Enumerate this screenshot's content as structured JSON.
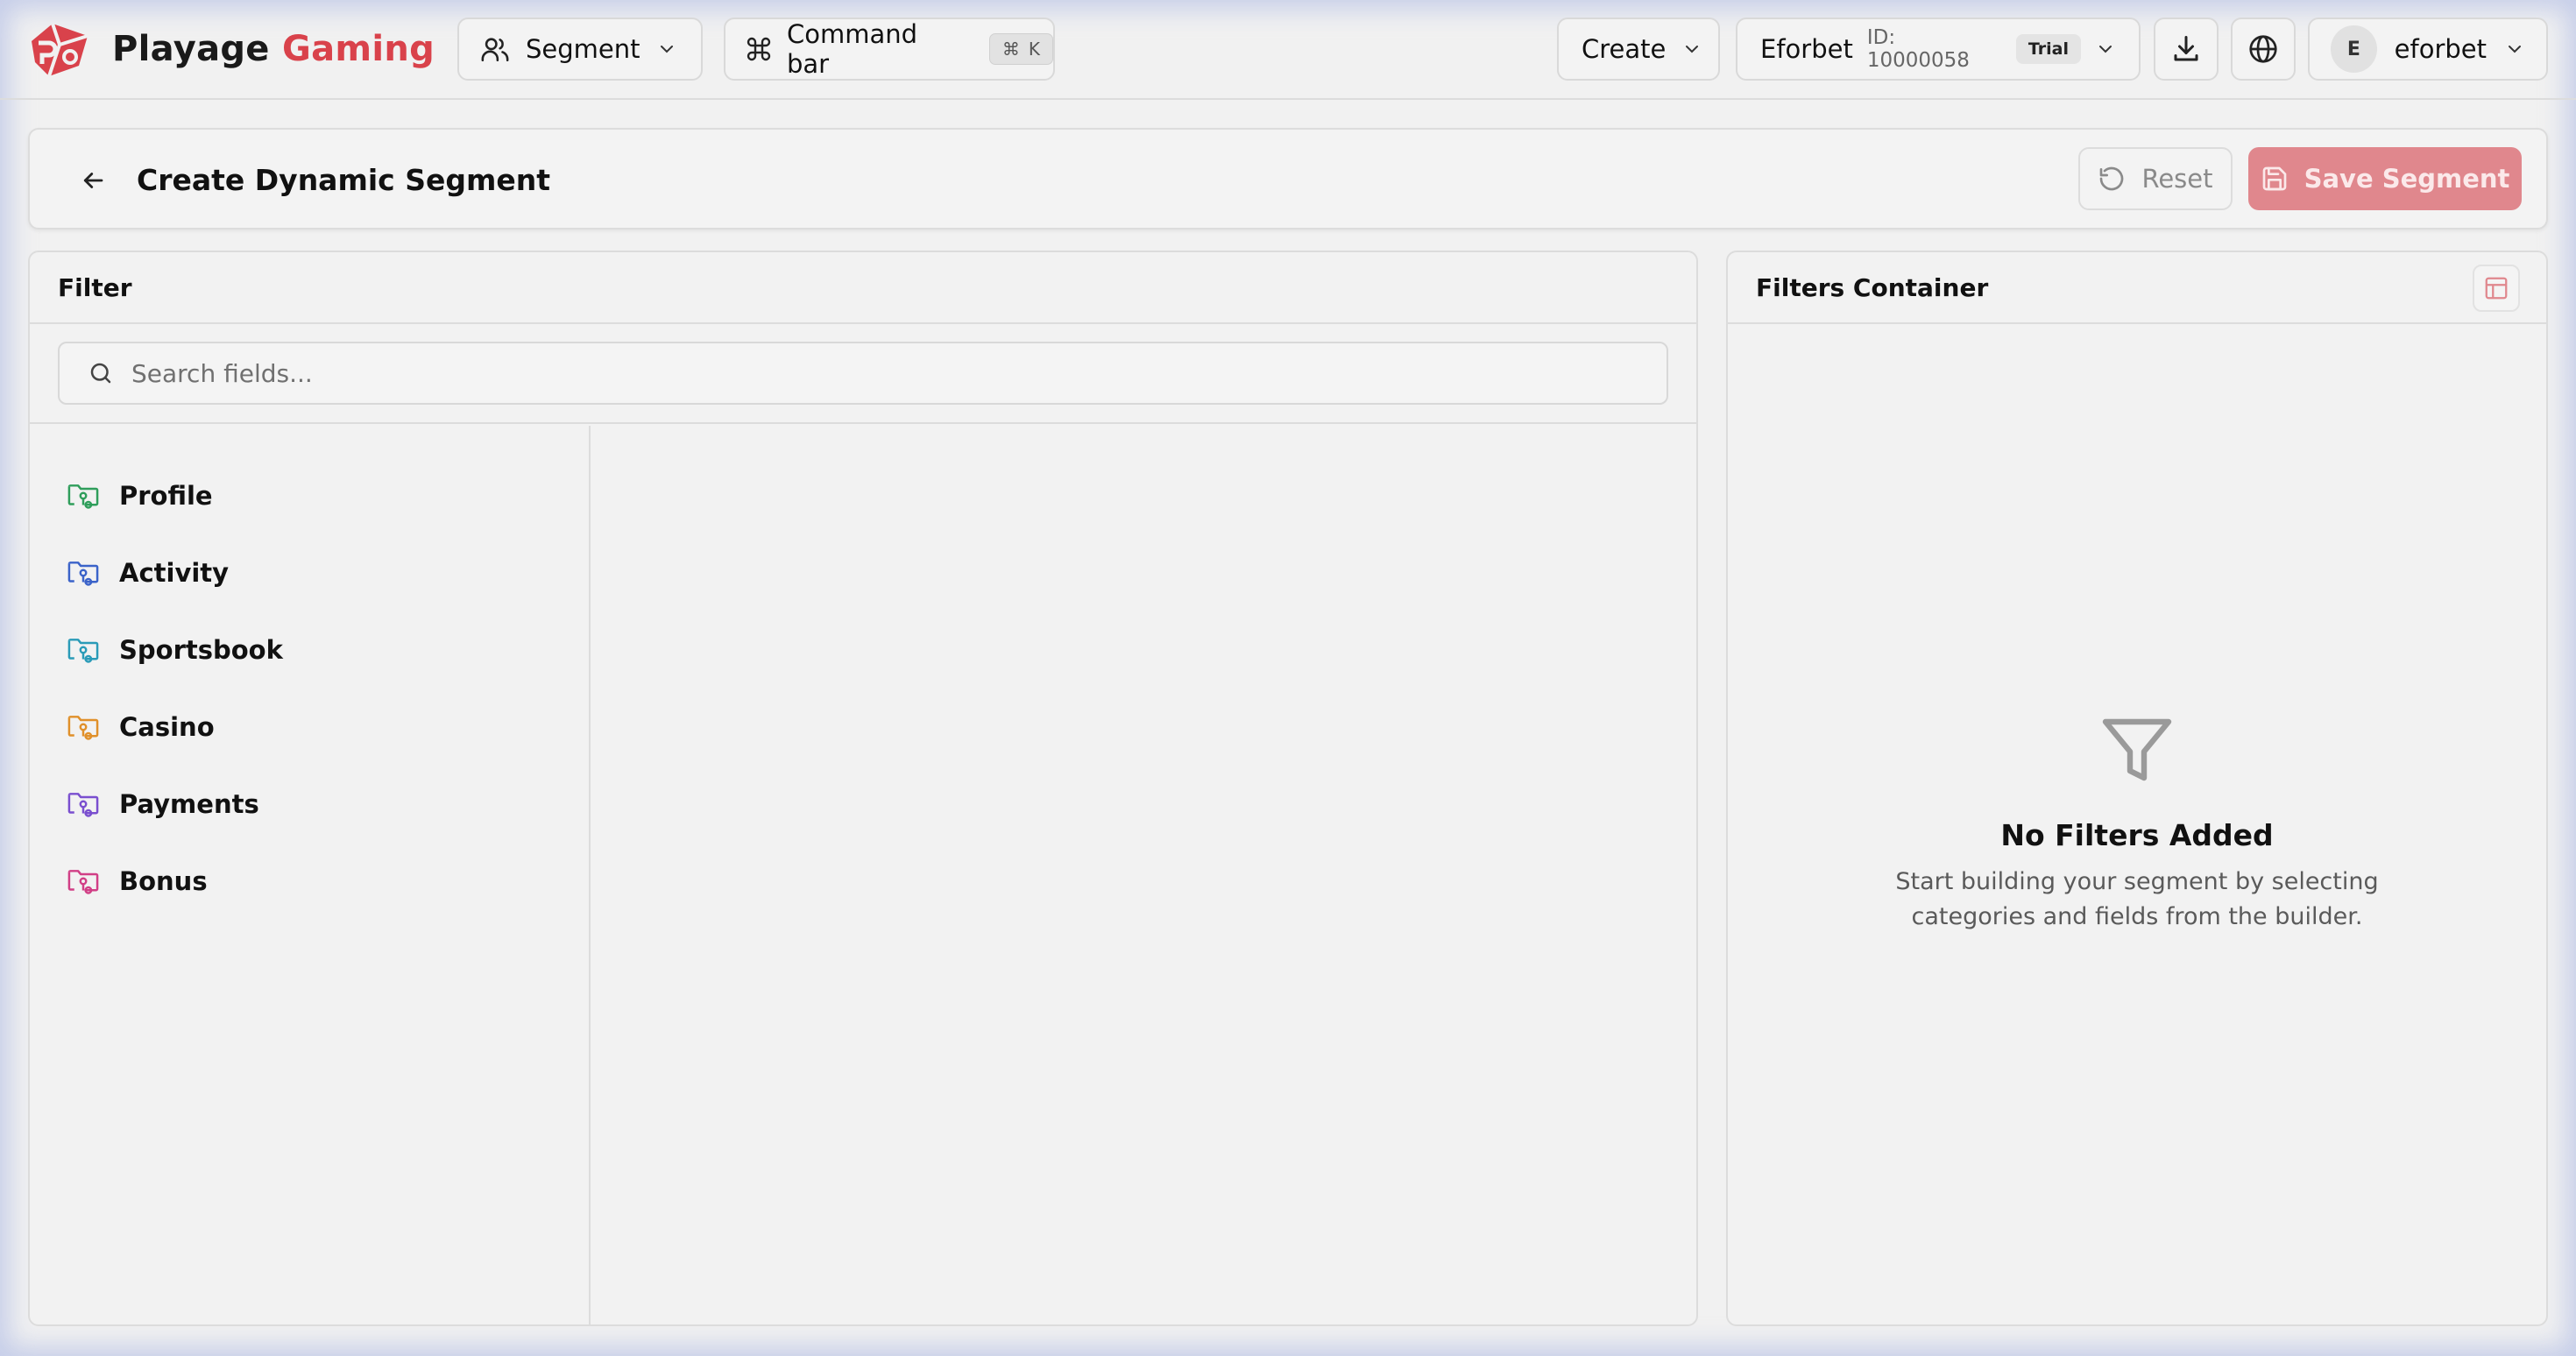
{
  "brand": {
    "name_part1": "Playage",
    "name_part2": "Gaming"
  },
  "topbar": {
    "segment_label": "Segment",
    "command_bar_label": "Command bar",
    "command_shortcut_key": "K",
    "create_label": "Create",
    "org_name": "Eforbet",
    "org_id": "ID: 10000058",
    "org_badge": "Trial",
    "user_initial": "E",
    "user_name": "eforbet"
  },
  "header": {
    "title": "Create Dynamic Segment",
    "reset_label": "Reset",
    "save_label": "Save Segment"
  },
  "filter_panel": {
    "title": "Filter",
    "search_placeholder": "Search fields...",
    "categories": [
      {
        "label": "Profile",
        "icon": "folder-icon",
        "color": "#2f9e5b"
      },
      {
        "label": "Activity",
        "icon": "folder-icon",
        "color": "#3b63c9"
      },
      {
        "label": "Sportsbook",
        "icon": "folder-icon",
        "color": "#2a9bb8"
      },
      {
        "label": "Casino",
        "icon": "folder-icon",
        "color": "#e0902a"
      },
      {
        "label": "Payments",
        "icon": "folder-icon",
        "color": "#7a4fcf"
      },
      {
        "label": "Bonus",
        "icon": "folder-icon",
        "color": "#d13f86"
      }
    ]
  },
  "filters_container": {
    "title": "Filters Container",
    "empty_title": "No Filters Added",
    "empty_description": "Start building your segment by selecting categories and fields from the builder."
  },
  "colors": {
    "brand_red": "#d9424b",
    "save_button": "#e0878d",
    "background": "#f1f1f1"
  }
}
